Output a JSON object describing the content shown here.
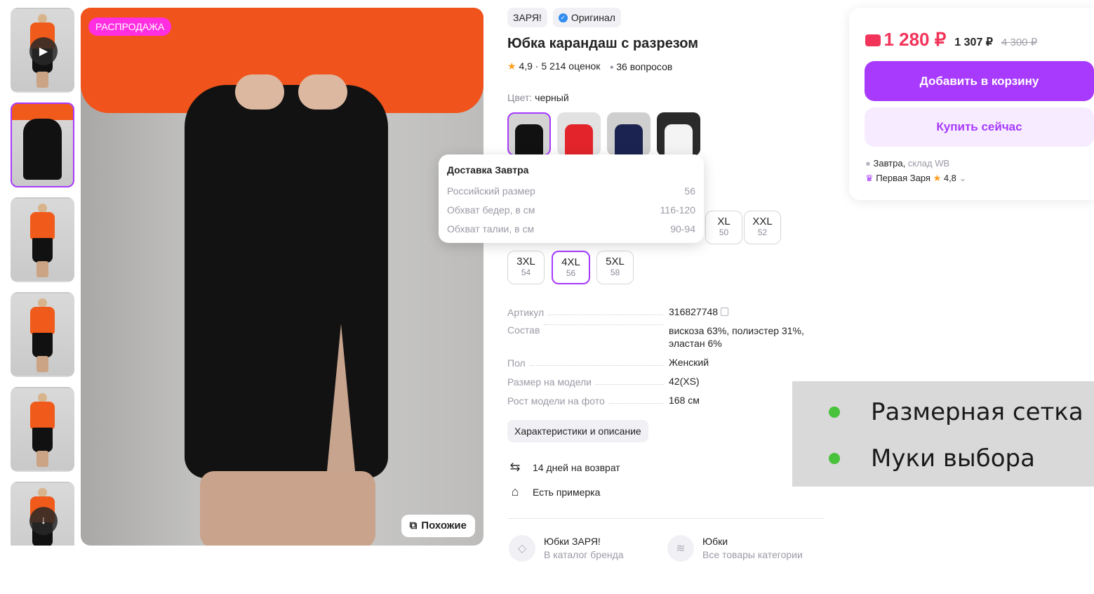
{
  "gallery": {
    "sale_badge": "РАСПРОДАЖА",
    "similar_button": "Похожие",
    "thumbnails": 6
  },
  "product": {
    "brand": "ЗАРЯ!",
    "original_badge": "Оригинал",
    "title": "Юбка карандаш с разрезом",
    "rating": "4,9",
    "reviews": "5 214 оценок",
    "questions": "36 вопросов",
    "color_label": "Цвет:",
    "color_value": "черный"
  },
  "tooltip": {
    "title": "Доставка Завтра",
    "rows": [
      {
        "label": "Российский размер",
        "value": "56"
      },
      {
        "label": "Обхват бедер, в см",
        "value": "116-120"
      },
      {
        "label": "Обхват талии, в см",
        "value": "90-94"
      }
    ]
  },
  "sizes": [
    {
      "size": "XL",
      "ru": "50"
    },
    {
      "size": "XXL",
      "ru": "52"
    },
    {
      "size": "3XL",
      "ru": "54"
    },
    {
      "size": "4XL",
      "ru": "56"
    },
    {
      "size": "5XL",
      "ru": "58"
    }
  ],
  "specs": [
    {
      "label": "Артикул",
      "value": "316827748"
    },
    {
      "label": "Состав",
      "value": "вискоза 63%, полиэстер 31%, эластан 6%"
    },
    {
      "label": "Пол",
      "value": "Женский"
    },
    {
      "label": "Размер на модели",
      "value": "42(XS)"
    },
    {
      "label": "Рост модели на фото",
      "value": "168 см"
    }
  ],
  "chars_button": "Характеристики и описание",
  "features": {
    "return": "14 дней на возврат",
    "fitting": "Есть примерка"
  },
  "categories": [
    {
      "title": "Юбки ЗАРЯ!",
      "subtitle": "В каталог бренда"
    },
    {
      "title": "Юбки",
      "subtitle": "Все товары категории"
    }
  ],
  "buy": {
    "price": "1 280 ₽",
    "price_wallet": "1 307 ₽",
    "price_old": "4 300 ₽",
    "add_to_cart": "Добавить в корзину",
    "buy_now": "Купить сейчас",
    "delivery_day": "Завтра,",
    "delivery_place": "склад WB",
    "seller_name": "Первая Заря",
    "seller_rating": "4,8",
    "accent_color": "#a73afd",
    "price_color": "#f2345a"
  },
  "slide": {
    "items": [
      "Размерная сетка",
      "Муки выбора"
    ],
    "bullet_color": "#47c23a"
  }
}
